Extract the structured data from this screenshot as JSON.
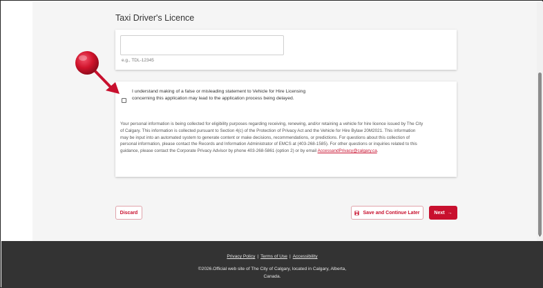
{
  "form": {
    "section_title": "Taxi Driver's Licence",
    "licence_input": {
      "value": "",
      "placeholder": ""
    },
    "licence_hint": "e.g., TDL-12345",
    "consent_checkbox": {
      "checked": false
    },
    "consent_label": "I understand making of a false or misleading statement to Vehicle for Hire Licensing concerning this application may lead to the application process being delayed.",
    "privacy_text": "Your personal information is being collected for eligibility purposes regarding receiving, renewing, and/or retaining a vehicle for hire licence issued by The City of Calgary. This information is collected pursuant to Section 4(c) of the Protection of Privacy Act and the Vehicle for Hire Bylaw 20M2021. This information may be input into an automated system to generate content or make decisions, recommendations, or predictions. For questions about this collection of personal information, please contact the Records and Information Administrator of EMCS at (403-268-1585). For other questions or inquiries related to this guidance, please contact the Corporate Privacy Advisor by phone 403-268-5861 (option 2) or by email ",
    "privacy_email": "AccessandPrivacy@calgary.ca",
    "privacy_end": "."
  },
  "actions": {
    "discard_label": "Discard",
    "save_label": "Save and Continue Later",
    "next_label": "Next",
    "next_arrow": "→"
  },
  "footer": {
    "privacy_policy": "Privacy Policy",
    "separator": "|",
    "terms_of_use": "Terms of Use",
    "accessibility": "Accessibility",
    "copyright": "©2026.Official web site of The City of Calgary, located in Calgary, Alberta, Canada."
  },
  "colors": {
    "accent": "#c8102e",
    "footer_bg": "#333333",
    "page_bg": "#f5f5f5",
    "annotation": "#d0142c"
  },
  "icons": {
    "save": "floppy-disk-icon",
    "next": "arrow-right-icon",
    "annotation": "pointer-arrow-icon"
  }
}
